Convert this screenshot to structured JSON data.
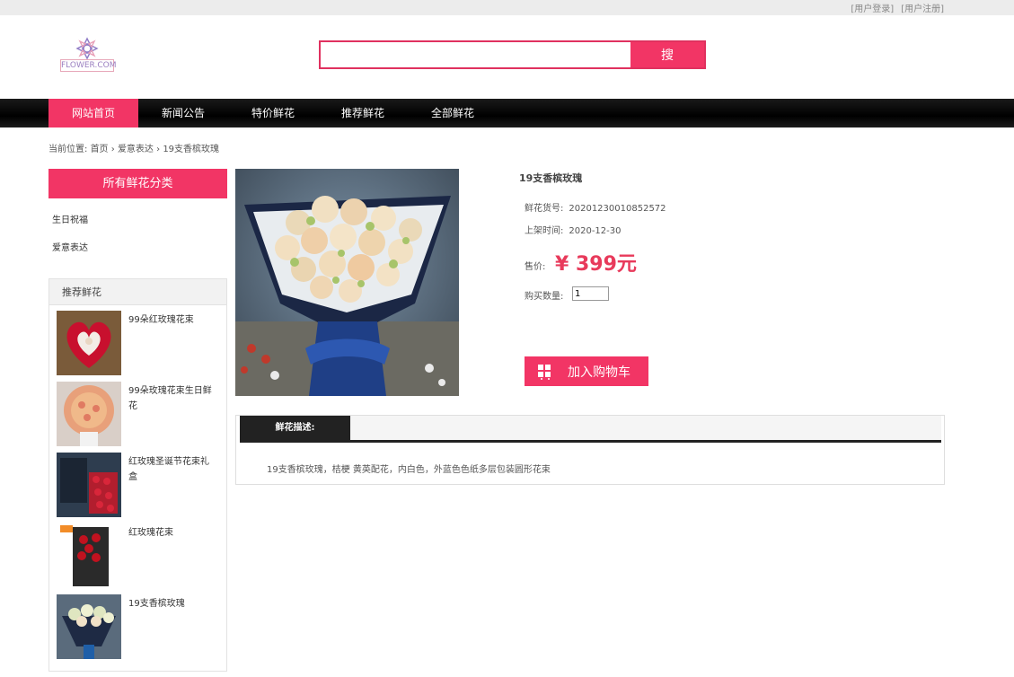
{
  "top_links": {
    "login": "[用户登录]",
    "register": "[用户注册]"
  },
  "logo": {
    "text": "FLOWER.COM"
  },
  "search": {
    "value": "",
    "button": "搜"
  },
  "nav": [
    {
      "label": "网站首页",
      "active": true
    },
    {
      "label": "新闻公告",
      "active": false
    },
    {
      "label": "特价鲜花",
      "active": false
    },
    {
      "label": "推荐鲜花",
      "active": false
    },
    {
      "label": "全部鲜花",
      "active": false
    }
  ],
  "breadcrumb": {
    "prefix": "当前位置:",
    "home": "首页",
    "sep": "›",
    "category": "爱意表达",
    "current": "19支香槟玫瑰"
  },
  "sidebar": {
    "category_title": "所有鲜花分类",
    "categories": [
      "生日祝福",
      "爱意表达"
    ],
    "recommend_title": "推荐鲜花",
    "recommend": [
      {
        "name": "99朵红玫瑰花束"
      },
      {
        "name": "99朵玫瑰花束生日鲜花"
      },
      {
        "name": "红玫瑰圣诞节花束礼盒"
      },
      {
        "name": "红玫瑰花束"
      },
      {
        "name": "19支香槟玫瑰"
      }
    ]
  },
  "product": {
    "title": "19支香槟玫瑰",
    "sku_label": "鲜花货号:",
    "sku": "20201230010852572",
    "date_label": "上架时间:",
    "date": "2020-12-30",
    "price_label": "售价:",
    "price": "¥ 399元",
    "qty_label": "购买数量:",
    "qty": "1",
    "cart_button": "加入购物车"
  },
  "description": {
    "tab": "鲜花描述:",
    "text": "19支香槟玫瑰，桔梗 黄英配花，内白色，外蓝色色纸多层包装圆形花束"
  },
  "colors": {
    "accent": "#f23565",
    "price": "#e83a5b",
    "nav_bg": "#000000"
  }
}
